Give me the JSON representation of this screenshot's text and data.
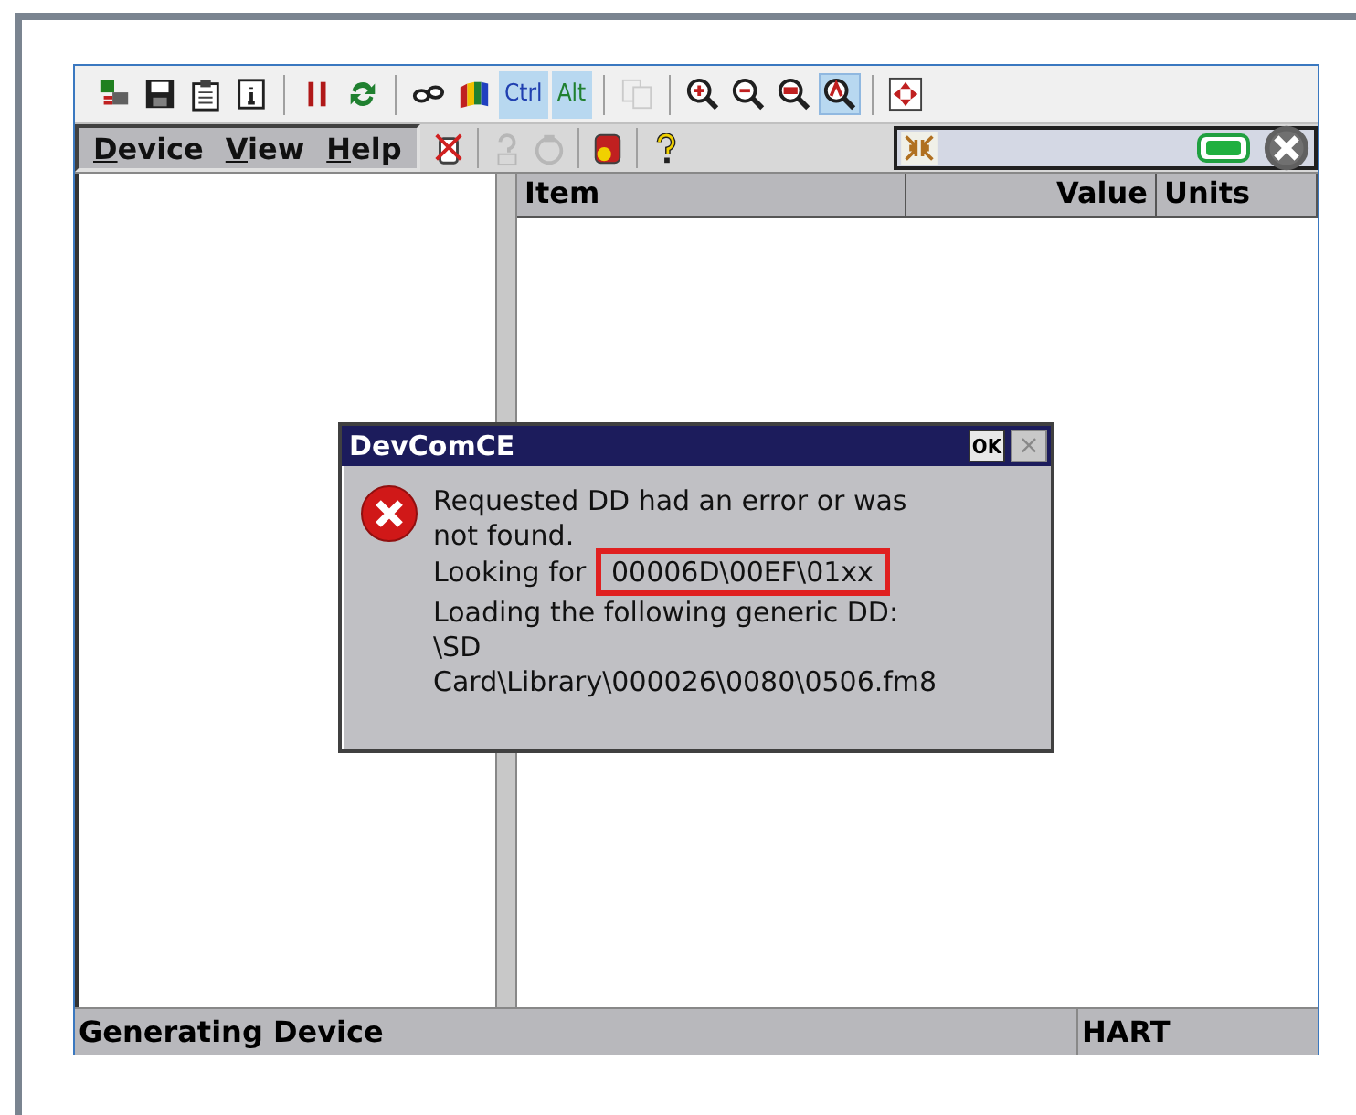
{
  "toolbar": [
    {
      "kind": "icon",
      "pressed": false,
      "disabled": false
    },
    {
      "kind": "icon",
      "pressed": false,
      "disabled": false
    },
    {
      "kind": "icon",
      "pressed": false,
      "disabled": false
    },
    {
      "kind": "icon",
      "pressed": false,
      "disabled": false
    },
    {
      "kind": "sep"
    },
    {
      "kind": "icon",
      "pressed": false,
      "disabled": false
    },
    {
      "kind": "icon",
      "pressed": false,
      "disabled": false
    },
    {
      "kind": "sep"
    },
    {
      "kind": "icon",
      "pressed": false,
      "disabled": false
    },
    {
      "kind": "icon",
      "pressed": false,
      "disabled": false
    },
    {
      "kind": "text",
      "label": "Ctrl",
      "pressed": true,
      "disabled": false
    },
    {
      "kind": "text",
      "label": "Alt",
      "pressed": true,
      "disabled": false
    },
    {
      "kind": "sep"
    },
    {
      "kind": "icon",
      "pressed": false,
      "disabled": true
    },
    {
      "kind": "sep"
    },
    {
      "kind": "icon",
      "pressed": false,
      "disabled": false
    },
    {
      "kind": "icon",
      "pressed": false,
      "disabled": false
    },
    {
      "kind": "icon",
      "pressed": false,
      "disabled": false
    },
    {
      "kind": "icon",
      "pressed": true,
      "disabled": false
    },
    {
      "kind": "sep"
    },
    {
      "kind": "icon",
      "pressed": false,
      "disabled": false
    }
  ],
  "menu": [
    {
      "label": "Device"
    },
    {
      "label": "View"
    },
    {
      "label": "Help"
    }
  ],
  "menu_tools": [
    {
      "kind": "icon",
      "disabled": false
    },
    {
      "kind": "sep"
    },
    {
      "kind": "icon",
      "disabled": true
    },
    {
      "kind": "icon",
      "disabled": true
    },
    {
      "kind": "sep"
    },
    {
      "kind": "icon",
      "disabled": false
    },
    {
      "kind": "sep"
    },
    {
      "kind": "icon",
      "disabled": false
    }
  ],
  "table": {
    "columns": [
      {
        "label": "Item"
      },
      {
        "label": "Value"
      },
      {
        "label": "Units"
      }
    ]
  },
  "dialog": {
    "title": "DevComCE",
    "ok": "OK",
    "close": "×",
    "lines": [
      "Requested DD had an error or was",
      "not found.",
      "Looking for ",
      "Loading the following generic DD:",
      "\\SD",
      "Card\\Library\\000026\\0080\\0506.fm8"
    ],
    "highlight": "00006D\\00EF\\01xx"
  },
  "status_bar": [
    "Generating Device",
    "HART"
  ]
}
